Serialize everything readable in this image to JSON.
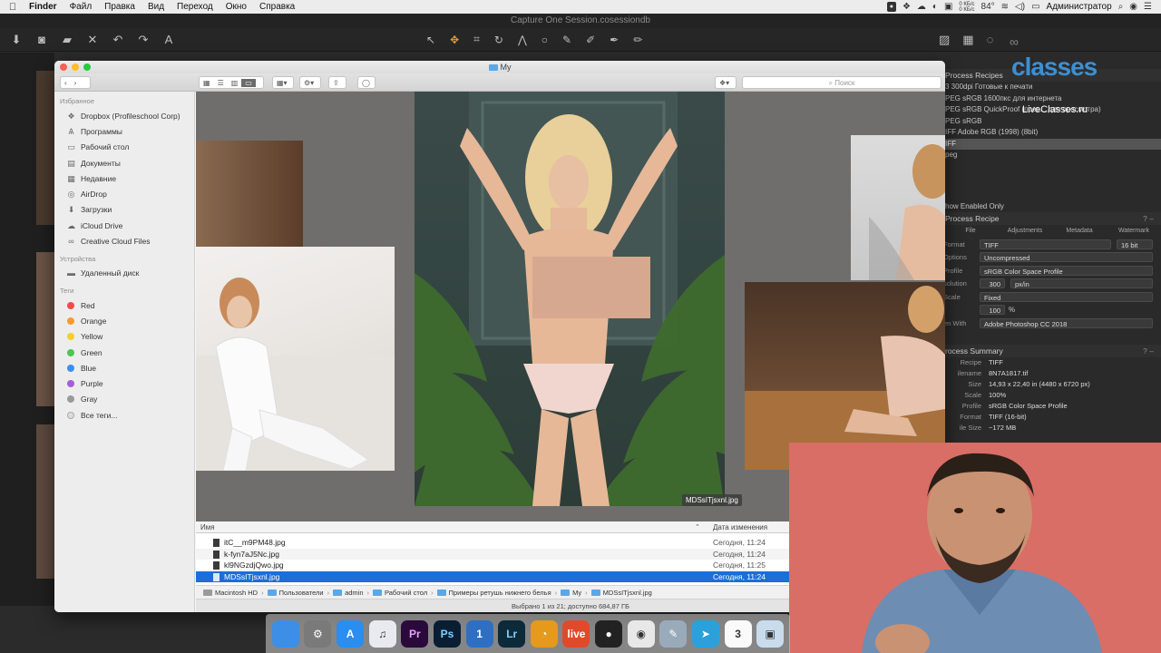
{
  "menubar": {
    "app": "Finder",
    "items": [
      "Файл",
      "Правка",
      "Вид",
      "Переход",
      "Окно",
      "Справка"
    ],
    "battery": "84°",
    "net_up": "0 КБ/с",
    "net_down": "0 КБ/с",
    "user": "Администратор"
  },
  "capture_one": {
    "title": "Capture One Session.cosessiondb"
  },
  "watermark": {
    "brand": "classes",
    "url": "LiveClasses.ru"
  },
  "process_recipes": {
    "header": "Process Recipes",
    "items": [
      "3 300dpi Готовые к печати",
      "PEG sRGB 1600пкс для интернета",
      "PEG sRGB QuickProof (прев... для просмотра)",
      "PEG sRGB",
      "IFF Adobe RGB (1998) (8bit)",
      "IFF",
      "peg"
    ],
    "selected_index": 5,
    "show_enabled": "how Enabled Only"
  },
  "process_recipe": {
    "header": "Process Recipe",
    "tabs": [
      "File",
      "Adjustments",
      "Metadata",
      "Watermark"
    ],
    "format_label": "Format",
    "format": "TIFF",
    "bit": "16 bit",
    "options_label": "Options",
    "options": "Uncompressed",
    "profile_label": "Profile",
    "profile": "sRGB Color Space Profile",
    "resolution_label": "solution",
    "resolution": "300",
    "resolution_unit": "px/in",
    "scale_label": "Scale",
    "scale": "Fixed",
    "scale_value": "100",
    "scale_unit": "%",
    "open_with_label": "en With",
    "open_with": "Adobe Photoshop CC 2018"
  },
  "process_summary": {
    "header": "rocess Summary",
    "rows": [
      {
        "label": "Recipe",
        "value": "TIFF"
      },
      {
        "label": "ilename",
        "value": "8N7A1817.tif"
      },
      {
        "label": "Size",
        "value": "14,93 x 22,40 in (4480 x 6720 px)"
      },
      {
        "label": "Scale",
        "value": "100%"
      },
      {
        "label": "Profile",
        "value": "sRGB Color Space Profile"
      },
      {
        "label": "Format",
        "value": "TIFF (16-bit)"
      },
      {
        "label": "ile Size",
        "value": "~172 MB"
      }
    ]
  },
  "finder": {
    "title": "My",
    "search_placeholder": "Поиск",
    "sidebar": {
      "favorites_label": "Избранное",
      "favorites": [
        {
          "label": "Dropbox (Profileschool Corp)",
          "icon": "dropbox-icon",
          "glyph": "❖"
        },
        {
          "label": "Программы",
          "icon": "applications-icon",
          "glyph": "Ѧ"
        },
        {
          "label": "Рабочий стол",
          "icon": "desktop-icon",
          "glyph": "▭"
        },
        {
          "label": "Документы",
          "icon": "documents-icon",
          "glyph": "▤"
        },
        {
          "label": "Недавние",
          "icon": "recents-icon",
          "glyph": "▦"
        },
        {
          "label": "AirDrop",
          "icon": "airdrop-icon",
          "glyph": "◎"
        },
        {
          "label": "Загрузки",
          "icon": "downloads-icon",
          "glyph": "⬇"
        },
        {
          "label": "iCloud Drive",
          "icon": "cloud-icon",
          "glyph": "☁"
        },
        {
          "label": "Creative Cloud Files",
          "icon": "creative-cloud-icon",
          "glyph": "∞"
        }
      ],
      "devices_label": "Устройства",
      "devices": [
        {
          "label": "Удаленный диск",
          "icon": "remote-disk-icon",
          "glyph": "▬"
        }
      ],
      "tags_label": "Теги",
      "tags": [
        {
          "label": "Red",
          "color": "#f04b4b"
        },
        {
          "label": "Orange",
          "color": "#f59a32"
        },
        {
          "label": "Yellow",
          "color": "#f2cf2f"
        },
        {
          "label": "Green",
          "color": "#4cc553"
        },
        {
          "label": "Blue",
          "color": "#3a8ff0"
        },
        {
          "label": "Purple",
          "color": "#a45fd6"
        },
        {
          "label": "Gray",
          "color": "#9a9a9a"
        },
        {
          "label": "Все теги...",
          "color": "#dcdcdc"
        }
      ]
    },
    "preview_label": "MDSsITjsxnl.jpg",
    "list": {
      "col_name": "Имя",
      "col_date": "Дата изменения",
      "rows": [
        {
          "name": "itC__m9PM48.jpg",
          "date": "Сегодня, 11:24"
        },
        {
          "name": "k-fyn7aJ5Nc.jpg",
          "date": "Сегодня, 11:24"
        },
        {
          "name": "kl9NGzdjQwo.jpg",
          "date": "Сегодня, 11:25"
        },
        {
          "name": "MDSsITjsxnl.jpg",
          "date": "Сегодня, 11:24"
        }
      ],
      "selected_index": 3
    },
    "path": [
      "Macintosh HD",
      "Пользователи",
      "admin",
      "Рабочий стол",
      "Примеры ретушь нижнего белья",
      "My",
      "MDSsITjsxnl.jpg"
    ],
    "status": "Выбрано 1 из 21; доступно 684,87 ГБ"
  },
  "dock": [
    {
      "name": "finder-dock-icon",
      "label": "",
      "color": "#3d8ee6"
    },
    {
      "name": "system-preferences-dock-icon",
      "label": "⚙",
      "color": "#7a7a7a"
    },
    {
      "name": "app-store-dock-icon",
      "label": "A",
      "color": "#2a8df0"
    },
    {
      "name": "itunes-dock-icon",
      "label": "♫",
      "color": "#e9e9f0"
    },
    {
      "name": "premiere-dock-icon",
      "label": "Pr",
      "color": "#2a0a3a"
    },
    {
      "name": "photoshop-dock-icon",
      "label": "Ps",
      "color": "#0a1e33"
    },
    {
      "name": "1password-dock-icon",
      "label": "1",
      "color": "#2e6fc4"
    },
    {
      "name": "lightroom-dock-icon",
      "label": "Lr",
      "color": "#0d2a3a"
    },
    {
      "name": "capture-one-dock-icon",
      "label": "◔",
      "color": "#e59a1b"
    },
    {
      "name": "live-dock-icon",
      "label": "live",
      "color": "#e04a2a"
    },
    {
      "name": "camera-dock-icon",
      "label": "●",
      "color": "#222"
    },
    {
      "name": "chrome-dock-icon",
      "label": "◉",
      "color": "#e8e8e8"
    },
    {
      "name": "preview-dock-icon",
      "label": "✎",
      "color": "#9ab"
    },
    {
      "name": "telegram-dock-icon",
      "label": "➤",
      "color": "#2aa1da"
    },
    {
      "name": "calendar-dock-icon",
      "label": "3",
      "color": "#fafafa"
    },
    {
      "name": "screenshot-dock-icon",
      "label": "▣",
      "color": "#c8dcee"
    }
  ]
}
